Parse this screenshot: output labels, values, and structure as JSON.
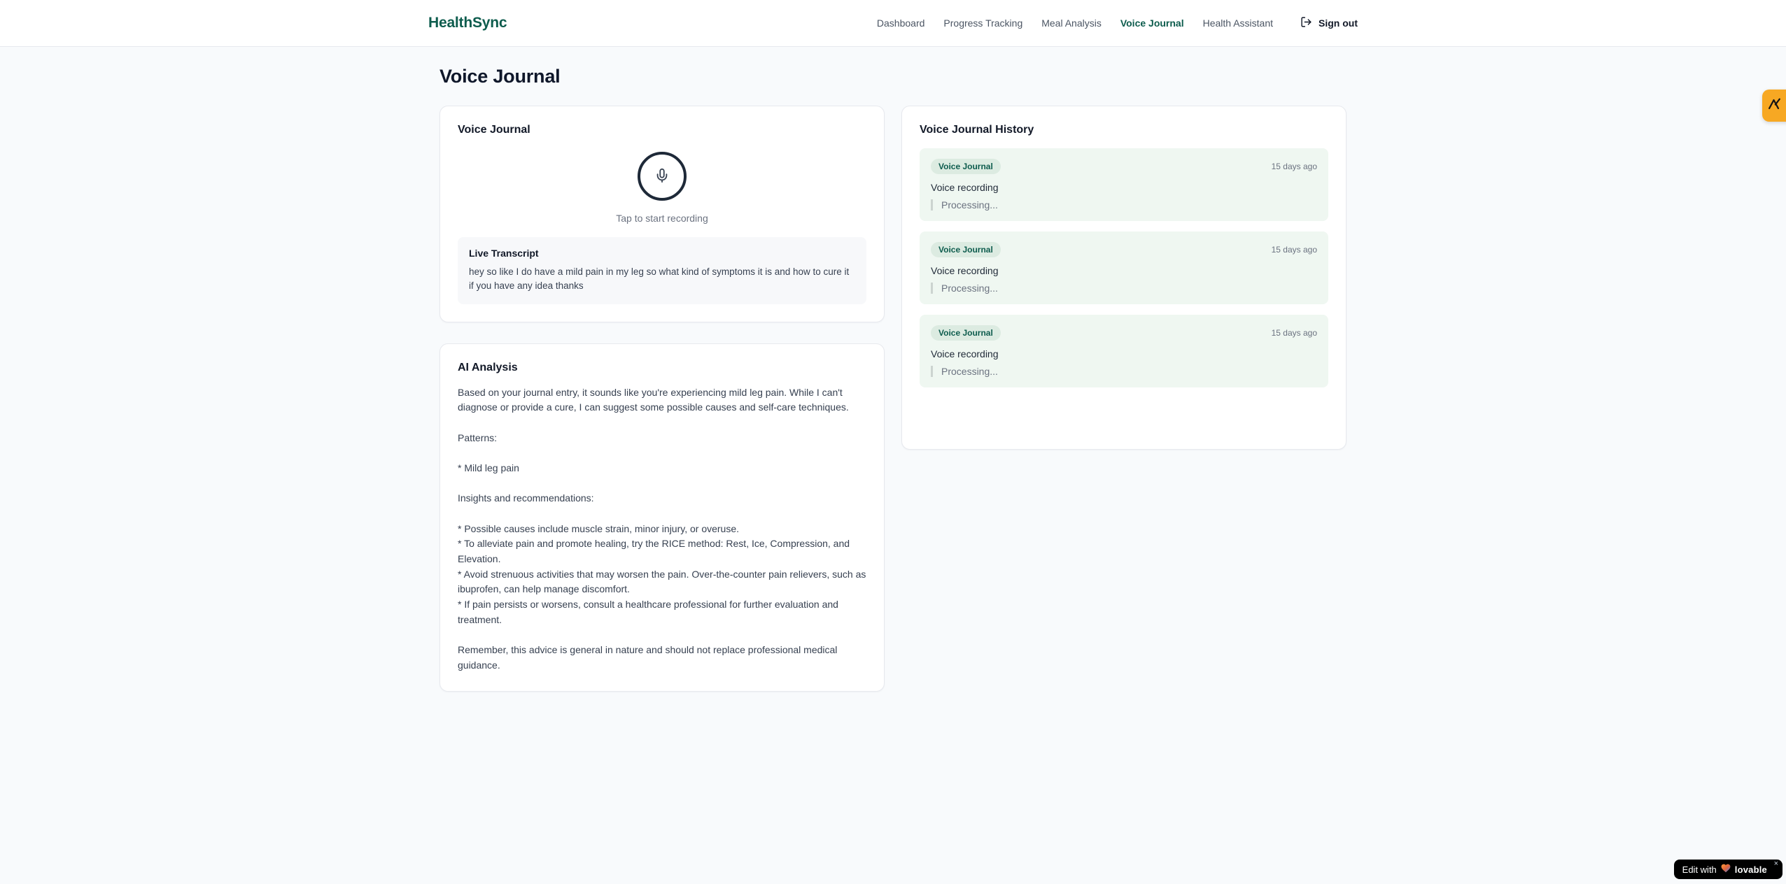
{
  "brand": {
    "name": "HealthSync",
    "color": "#0d5c4d"
  },
  "nav": {
    "items": [
      {
        "label": "Dashboard",
        "active": false
      },
      {
        "label": "Progress Tracking",
        "active": false
      },
      {
        "label": "Meal Analysis",
        "active": false
      },
      {
        "label": "Voice Journal",
        "active": true
      },
      {
        "label": "Health Assistant",
        "active": false
      }
    ],
    "sign_out_label": "Sign out"
  },
  "page": {
    "title": "Voice Journal"
  },
  "recorder_card": {
    "title": "Voice Journal",
    "mic_hint": "Tap to start recording",
    "transcript_title": "Live Transcript",
    "transcript_text": "hey so like I do have a mild pain in my leg so what kind of symptoms it is and how to cure it if you have any idea thanks"
  },
  "analysis_card": {
    "title": "AI Analysis",
    "body": "Based on your journal entry, it sounds like you're experiencing mild leg pain. While I can't diagnose or provide a cure, I can suggest some possible causes and self-care techniques.\n\nPatterns:\n\n* Mild leg pain\n\nInsights and recommendations:\n\n* Possible causes include muscle strain, minor injury, or overuse.\n* To alleviate pain and promote healing, try the RICE method: Rest, Ice, Compression, and Elevation.\n* Avoid strenuous activities that may worsen the pain. Over-the-counter pain relievers, such as ibuprofen, can help manage discomfort.\n* If pain persists or worsens, consult a healthcare professional for further evaluation and treatment.\n\nRemember, this advice is general in nature and should not replace professional medical guidance."
  },
  "history_card": {
    "title": "Voice Journal History",
    "items": [
      {
        "badge": "Voice Journal",
        "time": "15 days ago",
        "title": "Voice recording",
        "status": "Processing..."
      },
      {
        "badge": "Voice Journal",
        "time": "15 days ago",
        "title": "Voice recording",
        "status": "Processing..."
      },
      {
        "badge": "Voice Journal",
        "time": "15 days ago",
        "title": "Voice recording",
        "status": "Processing..."
      }
    ]
  },
  "widgets": {
    "edit_badge": {
      "prefix": "Edit with",
      "brand": "lovable",
      "close": "×"
    }
  },
  "colors": {
    "accent_green": "#0d5c4d",
    "history_item_bg": "#eff7f1",
    "badge_bg": "#dcebe1",
    "amber_fab": "#f7a823",
    "page_bg": "#f8fafc"
  }
}
